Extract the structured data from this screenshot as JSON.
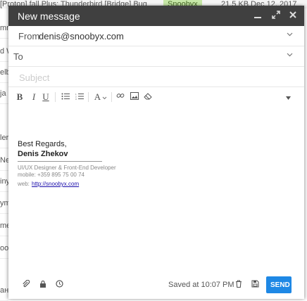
{
  "background": {
    "top_strip": {
      "snippet": "[Proton] fall Plus: Thunderbird [Bridge] Bug",
      "tag": "Snoobyx",
      "size": "21.5 KB",
      "date": "Dec 12, 2017"
    },
    "left_fragments": [
      "mm",
      "d W",
      "elb",
      "ja",
      "ler",
      "Nev",
      "iny",
      "ym",
      "me",
      "oo j",
      "ана"
    ]
  },
  "compose": {
    "title": "New message",
    "from_label": "From",
    "from_value": "denis@snoobyx.com",
    "to_label": "To",
    "subject_placeholder": "Subject",
    "toolbar": {
      "bold": "B",
      "italic": "I",
      "underline": "U",
      "font": "A"
    },
    "signature": {
      "regards": "Best Regards,",
      "name": "Denis Zhekov",
      "role": "UI/UX Designer & Front-End Developer",
      "mobile": "mobile: +359 895 75 00 74",
      "web_label": "web:",
      "web_link": "http://snoobyx.com"
    },
    "footer": {
      "saved_text": "Saved at 10:07 PM",
      "send_label": "SEND"
    }
  },
  "colors": {
    "title_bar": "#404040",
    "send_button": "#1e88e5",
    "link": "#1a0dab"
  }
}
